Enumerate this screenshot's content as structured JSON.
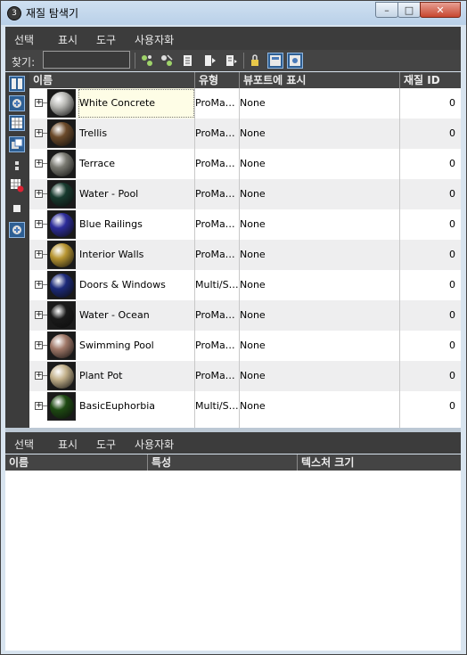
{
  "window": {
    "title": "재질 탐색기",
    "app_icon": "3ds-max-icon",
    "minimize_label": "–",
    "maximize_label": "□",
    "close_label": "✕"
  },
  "menu": [
    "선택",
    "표시",
    "도구",
    "사용자화"
  ],
  "find": {
    "label": "찾기:",
    "value": "",
    "placeholder": ""
  },
  "toolbar_icons": [
    "select-all-icon",
    "select-none-icon",
    "select-invert-icon",
    "sync-to-selection-icon",
    "select-children-icon",
    "select-dependents-icon",
    "lock-icon",
    "display-materials-icon",
    "display-maps-icon"
  ],
  "left_tools": [
    "display-thumbnails-icon",
    "display-scene-materials-icon",
    "display-maps-icon",
    "display-multi-sub-icon",
    "display-objects-icon",
    "display-missing-maps-icon",
    "display-unused-icon",
    "display-scene-icon"
  ],
  "table": {
    "columns": [
      "이름",
      "유형",
      "뷰포트에 표시",
      "재질 ID"
    ],
    "rows": [
      {
        "name": "White Concrete",
        "type": "ProMa…",
        "viewport": "None",
        "id": "0",
        "swatch": "#b8b8b4"
      },
      {
        "name": "Trellis",
        "type": "ProMa…",
        "viewport": "None",
        "id": "0",
        "swatch": "#6b4a2a"
      },
      {
        "name": "Terrace",
        "type": "ProMa…",
        "viewport": "None",
        "id": "0",
        "swatch": "#7a7a72"
      },
      {
        "name": "Water - Pool",
        "type": "ProMa…",
        "viewport": "None",
        "id": "0",
        "swatch": "#173a2e"
      },
      {
        "name": "Blue Railings",
        "type": "ProMa…",
        "viewport": "None",
        "id": "0",
        "swatch": "#2c2c9a"
      },
      {
        "name": "Interior Walls",
        "type": "ProMa…",
        "viewport": "None",
        "id": "0",
        "swatch": "#b89632"
      },
      {
        "name": "Doors & Windows",
        "type": "Multi/S…",
        "viewport": "None",
        "id": "0",
        "swatch": "#1c2a7a"
      },
      {
        "name": "Water - Ocean",
        "type": "ProMa…",
        "viewport": "None",
        "id": "0",
        "swatch": "#1a1a1a"
      },
      {
        "name": "Swimming Pool",
        "type": "ProMa…",
        "viewport": "None",
        "id": "0",
        "swatch": "#a07868"
      },
      {
        "name": "Plant Pot",
        "type": "ProMa…",
        "viewport": "None",
        "id": "0",
        "swatch": "#c2b08a"
      },
      {
        "name": "BasicEuphorbia",
        "type": "Multi/S…",
        "viewport": "None",
        "id": "0",
        "swatch": "#1e4a12"
      }
    ]
  },
  "bottom": {
    "menu": [
      "선택",
      "표시",
      "도구",
      "사용자화"
    ],
    "columns": [
      "이름",
      "특성",
      "텍스처 크기"
    ]
  },
  "colors": {
    "panel": "#3c3c3c",
    "header": "#444444",
    "title_bar": "#c4d8ee",
    "selected_row": "#fefde6"
  }
}
